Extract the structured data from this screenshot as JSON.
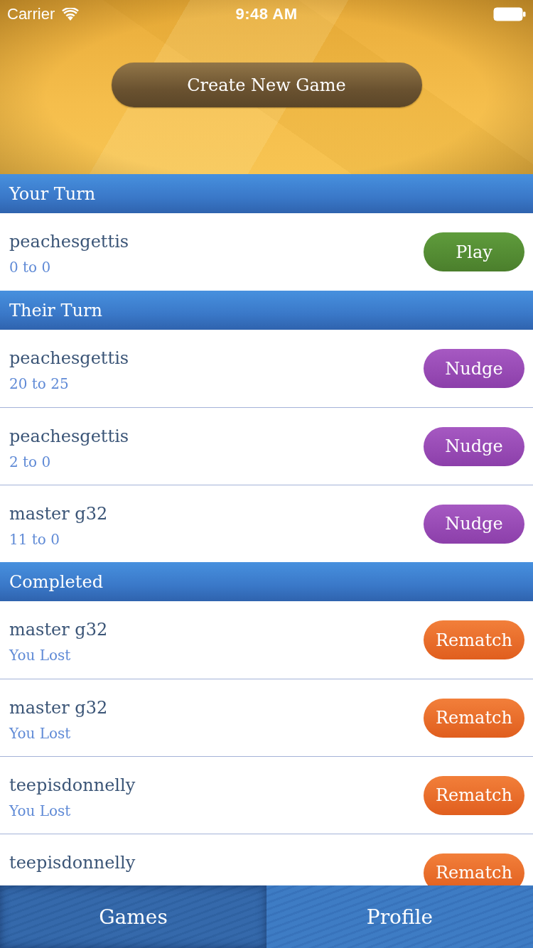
{
  "status_bar": {
    "carrier": "Carrier",
    "time": "9:48 AM"
  },
  "header": {
    "create_button": "Create New Game"
  },
  "sections": [
    {
      "title": "Your Turn",
      "games": [
        {
          "opponent": "peachesgettis",
          "detail": "0 to 0",
          "action": {
            "kind": "play",
            "label": "Play"
          }
        }
      ]
    },
    {
      "title": "Their Turn",
      "games": [
        {
          "opponent": "peachesgettis",
          "detail": "20 to 25",
          "action": {
            "kind": "nudge",
            "label": "Nudge"
          }
        },
        {
          "opponent": "peachesgettis",
          "detail": "2 to 0",
          "action": {
            "kind": "nudge",
            "label": "Nudge"
          }
        },
        {
          "opponent": "master g32",
          "detail": "11 to 0",
          "action": {
            "kind": "nudge",
            "label": "Nudge"
          }
        }
      ]
    },
    {
      "title": "Completed",
      "games": [
        {
          "opponent": "master g32",
          "detail": "You Lost",
          "action": {
            "kind": "rematch",
            "label": "Rematch"
          }
        },
        {
          "opponent": "master g32",
          "detail": "You Lost",
          "action": {
            "kind": "rematch",
            "label": "Rematch"
          }
        },
        {
          "opponent": "teepisdonnelly",
          "detail": "You Lost",
          "action": {
            "kind": "rematch",
            "label": "Rematch"
          }
        },
        {
          "opponent": "teepisdonnelly",
          "action": {
            "kind": "rematch",
            "label": "Rematch"
          }
        }
      ]
    }
  ],
  "tab_bar": {
    "tabs": [
      {
        "label": "Games",
        "selected": true
      },
      {
        "label": "Profile",
        "selected": false
      }
    ]
  }
}
